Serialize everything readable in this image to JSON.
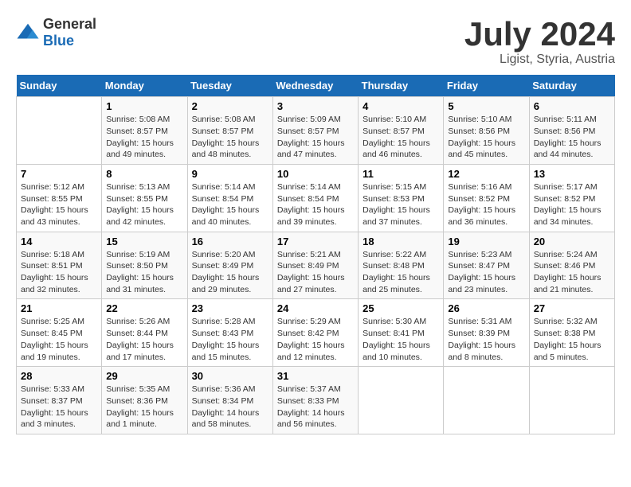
{
  "logo": {
    "general": "General",
    "blue": "Blue"
  },
  "title": "July 2024",
  "subtitle": "Ligist, Styria, Austria",
  "days_header": [
    "Sunday",
    "Monday",
    "Tuesday",
    "Wednesday",
    "Thursday",
    "Friday",
    "Saturday"
  ],
  "weeks": [
    [
      {
        "num": "",
        "info": ""
      },
      {
        "num": "1",
        "info": "Sunrise: 5:08 AM\nSunset: 8:57 PM\nDaylight: 15 hours\nand 49 minutes."
      },
      {
        "num": "2",
        "info": "Sunrise: 5:08 AM\nSunset: 8:57 PM\nDaylight: 15 hours\nand 48 minutes."
      },
      {
        "num": "3",
        "info": "Sunrise: 5:09 AM\nSunset: 8:57 PM\nDaylight: 15 hours\nand 47 minutes."
      },
      {
        "num": "4",
        "info": "Sunrise: 5:10 AM\nSunset: 8:57 PM\nDaylight: 15 hours\nand 46 minutes."
      },
      {
        "num": "5",
        "info": "Sunrise: 5:10 AM\nSunset: 8:56 PM\nDaylight: 15 hours\nand 45 minutes."
      },
      {
        "num": "6",
        "info": "Sunrise: 5:11 AM\nSunset: 8:56 PM\nDaylight: 15 hours\nand 44 minutes."
      }
    ],
    [
      {
        "num": "7",
        "info": "Sunrise: 5:12 AM\nSunset: 8:55 PM\nDaylight: 15 hours\nand 43 minutes."
      },
      {
        "num": "8",
        "info": "Sunrise: 5:13 AM\nSunset: 8:55 PM\nDaylight: 15 hours\nand 42 minutes."
      },
      {
        "num": "9",
        "info": "Sunrise: 5:14 AM\nSunset: 8:54 PM\nDaylight: 15 hours\nand 40 minutes."
      },
      {
        "num": "10",
        "info": "Sunrise: 5:14 AM\nSunset: 8:54 PM\nDaylight: 15 hours\nand 39 minutes."
      },
      {
        "num": "11",
        "info": "Sunrise: 5:15 AM\nSunset: 8:53 PM\nDaylight: 15 hours\nand 37 minutes."
      },
      {
        "num": "12",
        "info": "Sunrise: 5:16 AM\nSunset: 8:52 PM\nDaylight: 15 hours\nand 36 minutes."
      },
      {
        "num": "13",
        "info": "Sunrise: 5:17 AM\nSunset: 8:52 PM\nDaylight: 15 hours\nand 34 minutes."
      }
    ],
    [
      {
        "num": "14",
        "info": "Sunrise: 5:18 AM\nSunset: 8:51 PM\nDaylight: 15 hours\nand 32 minutes."
      },
      {
        "num": "15",
        "info": "Sunrise: 5:19 AM\nSunset: 8:50 PM\nDaylight: 15 hours\nand 31 minutes."
      },
      {
        "num": "16",
        "info": "Sunrise: 5:20 AM\nSunset: 8:49 PM\nDaylight: 15 hours\nand 29 minutes."
      },
      {
        "num": "17",
        "info": "Sunrise: 5:21 AM\nSunset: 8:49 PM\nDaylight: 15 hours\nand 27 minutes."
      },
      {
        "num": "18",
        "info": "Sunrise: 5:22 AM\nSunset: 8:48 PM\nDaylight: 15 hours\nand 25 minutes."
      },
      {
        "num": "19",
        "info": "Sunrise: 5:23 AM\nSunset: 8:47 PM\nDaylight: 15 hours\nand 23 minutes."
      },
      {
        "num": "20",
        "info": "Sunrise: 5:24 AM\nSunset: 8:46 PM\nDaylight: 15 hours\nand 21 minutes."
      }
    ],
    [
      {
        "num": "21",
        "info": "Sunrise: 5:25 AM\nSunset: 8:45 PM\nDaylight: 15 hours\nand 19 minutes."
      },
      {
        "num": "22",
        "info": "Sunrise: 5:26 AM\nSunset: 8:44 PM\nDaylight: 15 hours\nand 17 minutes."
      },
      {
        "num": "23",
        "info": "Sunrise: 5:28 AM\nSunset: 8:43 PM\nDaylight: 15 hours\nand 15 minutes."
      },
      {
        "num": "24",
        "info": "Sunrise: 5:29 AM\nSunset: 8:42 PM\nDaylight: 15 hours\nand 12 minutes."
      },
      {
        "num": "25",
        "info": "Sunrise: 5:30 AM\nSunset: 8:41 PM\nDaylight: 15 hours\nand 10 minutes."
      },
      {
        "num": "26",
        "info": "Sunrise: 5:31 AM\nSunset: 8:39 PM\nDaylight: 15 hours\nand 8 minutes."
      },
      {
        "num": "27",
        "info": "Sunrise: 5:32 AM\nSunset: 8:38 PM\nDaylight: 15 hours\nand 5 minutes."
      }
    ],
    [
      {
        "num": "28",
        "info": "Sunrise: 5:33 AM\nSunset: 8:37 PM\nDaylight: 15 hours\nand 3 minutes."
      },
      {
        "num": "29",
        "info": "Sunrise: 5:35 AM\nSunset: 8:36 PM\nDaylight: 15 hours\nand 1 minute."
      },
      {
        "num": "30",
        "info": "Sunrise: 5:36 AM\nSunset: 8:34 PM\nDaylight: 14 hours\nand 58 minutes."
      },
      {
        "num": "31",
        "info": "Sunrise: 5:37 AM\nSunset: 8:33 PM\nDaylight: 14 hours\nand 56 minutes."
      },
      {
        "num": "",
        "info": ""
      },
      {
        "num": "",
        "info": ""
      },
      {
        "num": "",
        "info": ""
      }
    ]
  ]
}
